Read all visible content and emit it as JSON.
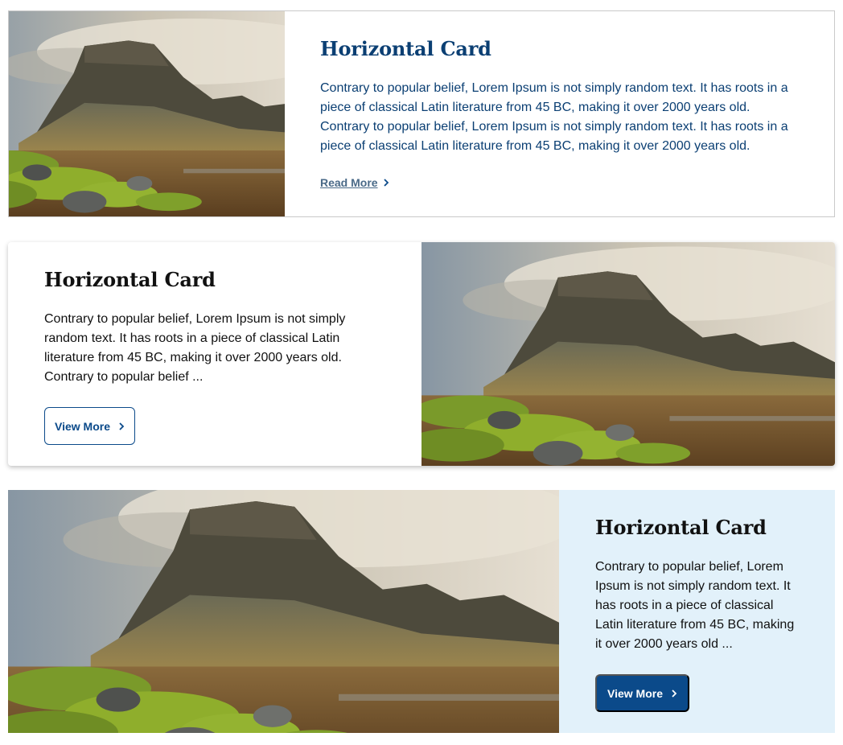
{
  "cards": [
    {
      "title": "Horizontal Card",
      "body": "Contrary to popular belief, Lorem Ipsum is not simply random text. It has roots in a piece of classical Latin literature from 45 BC, making it over 2000 years old. Contrary to popular belief, Lorem Ipsum is not simply random text. It has roots in a piece of classical Latin literature from 45 BC, making it over 2000 years old.",
      "action_label": "Read More",
      "action_icon": "chevron-right-icon"
    },
    {
      "title": "Horizontal Card",
      "body": "Contrary to popular belief, Lorem Ipsum is not simply random text. It has roots in a piece of classical Latin literature from 45 BC, making it over 2000 years old. Contrary to popular belief ...",
      "action_label": "View More",
      "action_icon": "chevron-right-icon"
    },
    {
      "title": "Horizontal Card",
      "body": "Contrary to popular belief, Lorem Ipsum is not simply random text. It has roots in a piece of classical Latin literature from 45 BC, making it over 2000 years old ...",
      "action_label": "View More",
      "action_icon": "chevron-right-icon"
    }
  ],
  "colors": {
    "primary": "#0b4a8a",
    "title_dark_blue": "#0b3f73",
    "light_blue_bg": "#e2f1fa"
  }
}
